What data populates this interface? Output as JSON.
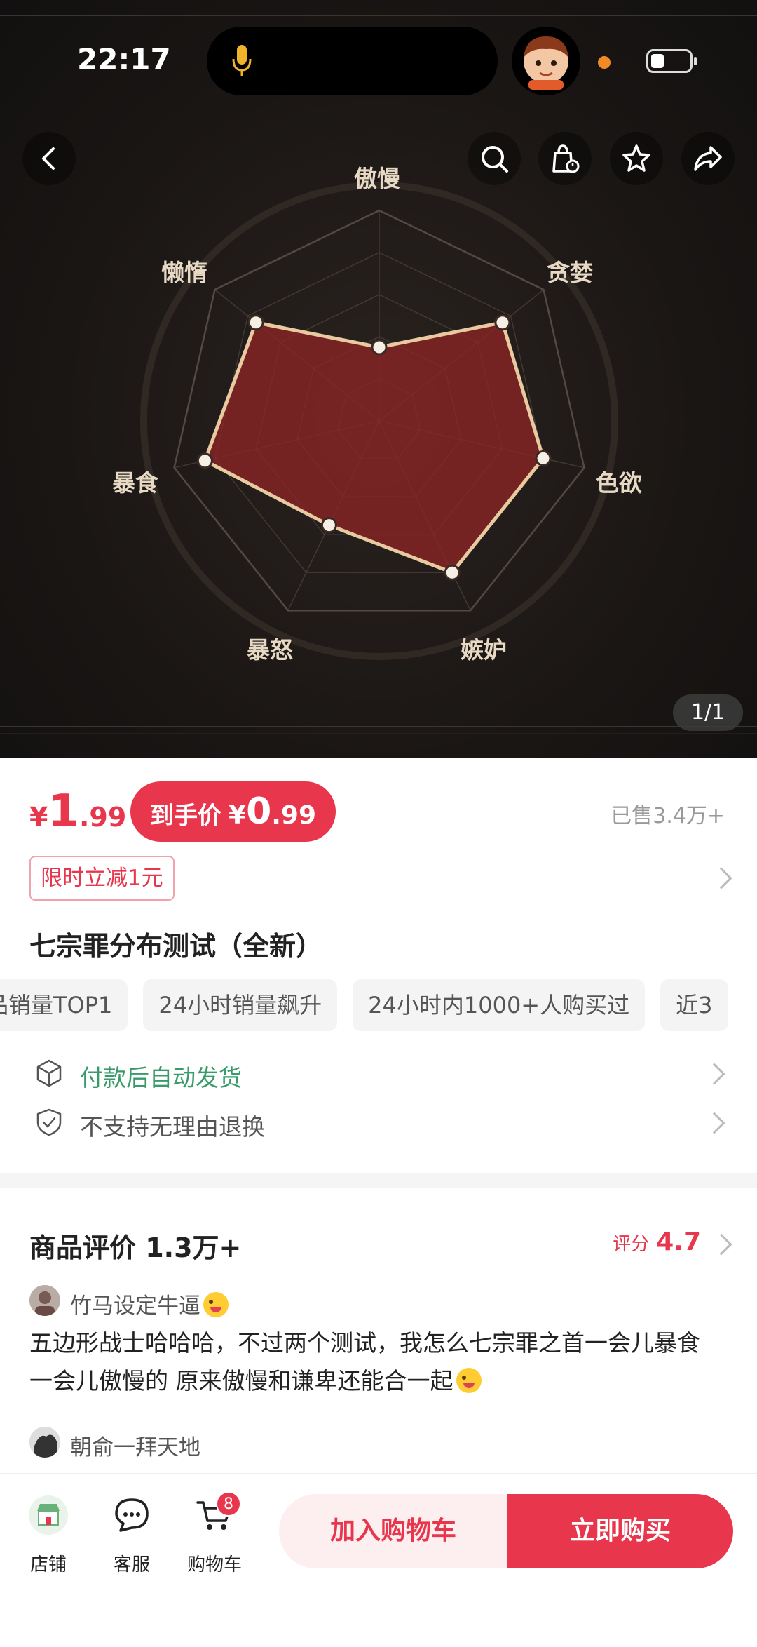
{
  "status_bar": {
    "time": "22:17"
  },
  "hero": {
    "axis_labels": [
      "傲慢",
      "贪婪",
      "色欲",
      "嫉妒",
      "暴怒",
      "暴食",
      "懒惰"
    ],
    "page_indicator": "1/1"
  },
  "chart_data": {
    "type": "radar",
    "title": "",
    "categories": [
      "傲慢",
      "贪婪",
      "色欲",
      "嫉妒",
      "暴怒",
      "暴食",
      "懒惰"
    ],
    "values": [
      0.35,
      0.75,
      0.8,
      0.8,
      0.55,
      0.85,
      0.75
    ],
    "range": [
      0,
      1
    ],
    "levels": 5,
    "grid": true,
    "colors": {
      "fill": "#8a2424",
      "stroke": "#e8c9a0",
      "grid": "#5a4f47"
    }
  },
  "price": {
    "symbol": "¥",
    "integer": "1",
    "decimal": ".99",
    "final_label": "到手价",
    "final_symbol": "¥",
    "final_integer": "0",
    "final_decimal": ".99",
    "sold": "已售3.4万+"
  },
  "promo": {
    "tag": "限时立减1元"
  },
  "product": {
    "title": "七宗罪分布测试（全新）"
  },
  "chips": [
    "品销量TOP1",
    "24小时销量飙升",
    "24小时内1000+人购买过",
    "近3"
  ],
  "services": [
    {
      "text": "付款后自动发货",
      "icon": "cube-icon",
      "color": "#3a9b6a"
    },
    {
      "text": "不支持无理由退换",
      "icon": "shield-check-icon",
      "color": "#555555"
    }
  ],
  "reviews": {
    "title": "商品评价 1.3万+",
    "score_label": "评分",
    "score": "4.7",
    "items": [
      {
        "user": "竹马设定牛逼",
        "text": "五边形战士哈哈哈，不过两个测试，我怎么七宗罪之首一会儿暴食  一会儿傲慢的  原来傲慢和谦卑还能合一起"
      },
      {
        "user": "朝俞一拜天地"
      }
    ]
  },
  "bottom_bar": {
    "shop": "店铺",
    "service": "客服",
    "cart": "购物车",
    "cart_badge": "8",
    "add_to_cart": "加入购物车",
    "buy_now": "立即购买"
  },
  "colors": {
    "accent": "#e8364c",
    "service_green": "#3a9b6a"
  }
}
